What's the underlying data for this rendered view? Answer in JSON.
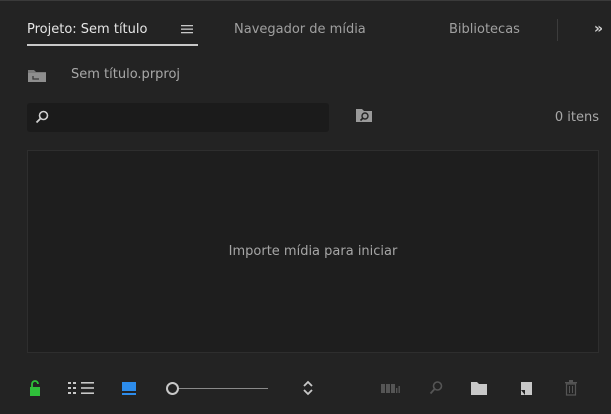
{
  "tabs": [
    {
      "label": "Projeto: Sem título",
      "active": true
    },
    {
      "label": "Navegador de mídia",
      "active": false
    },
    {
      "label": "Bibliotecas",
      "active": false
    }
  ],
  "overflow_symbol": "»",
  "project": {
    "file_name": "Sem título.prproj"
  },
  "search": {
    "placeholder": "",
    "value": ""
  },
  "item_count": "0 itens",
  "empty_message": "Importe mídia para iniciar",
  "toolbar": {
    "zoom_level": 0,
    "icons": [
      "lock-icon",
      "list-view-icon",
      "icon-view-icon",
      "zoom-slider",
      "sort-icon",
      "automate-to-sequence-icon",
      "find-icon",
      "new-bin-icon",
      "new-item-icon",
      "clear-icon"
    ]
  },
  "colors": {
    "lock": "#2fbf3a",
    "icon_view": "#2d8ceb",
    "background": "#232323"
  }
}
